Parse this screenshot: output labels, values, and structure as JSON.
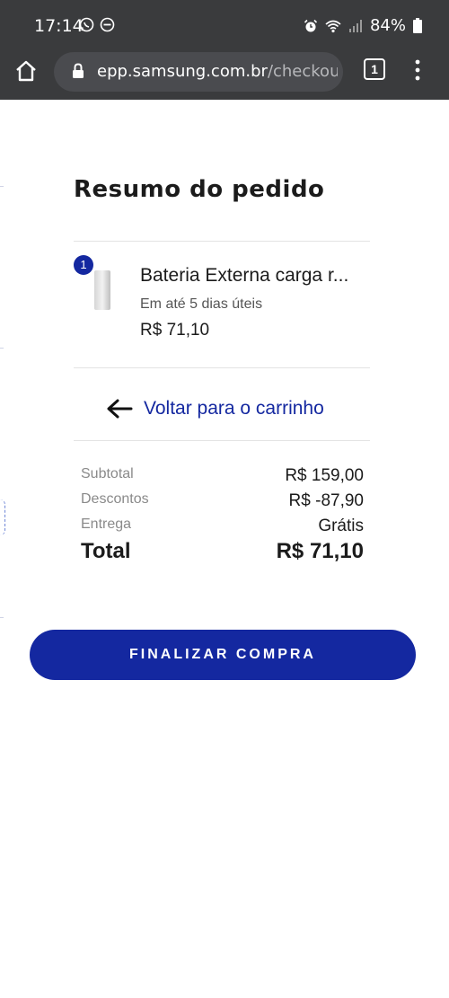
{
  "status_bar": {
    "time": "17:14",
    "battery": "84%",
    "icons": [
      "whatsapp-icon",
      "dnd-icon",
      "alarm-icon",
      "wifi-icon",
      "signal-icon",
      "battery-icon"
    ]
  },
  "browser": {
    "url_host": "epp.samsung.com.br",
    "url_path": "/checkout/#",
    "tab_count": "1"
  },
  "order_summary": {
    "title": "Resumo do pedido",
    "item": {
      "quantity": "1",
      "name": "Bateria Externa carga r...",
      "delivery": "Em até 5 dias úteis",
      "price": "R$ 71,10"
    },
    "back_link": "Voltar para o carrinho",
    "subtotal_label": "Subtotal",
    "subtotal_value": "R$ 159,00",
    "discount_label": "Descontos",
    "discount_value": "R$ -87,90",
    "shipping_label": "Entrega",
    "shipping_value": "Grátis",
    "total_label": "Total",
    "total_value": "R$ 71,10"
  },
  "checkout_button": "FINALIZAR COMPRA",
  "colors": {
    "brand": "#1428a0",
    "browser_bar": "#3a3b3d",
    "url_box": "#4a4b4f"
  }
}
